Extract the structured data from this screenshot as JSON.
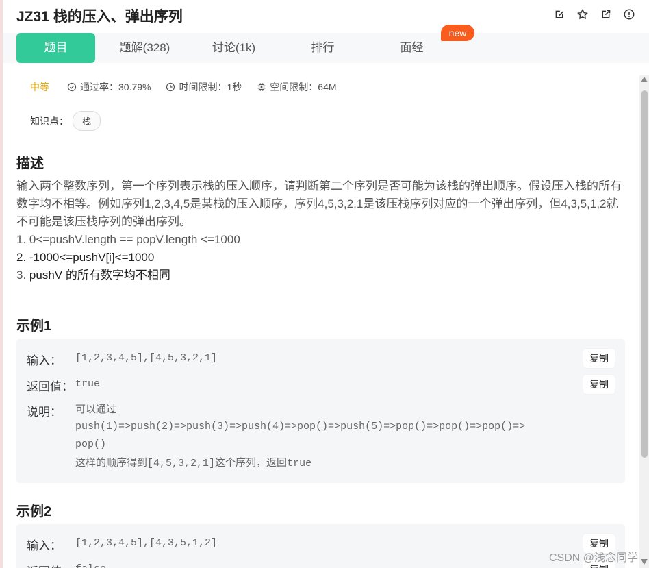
{
  "header": {
    "title": "JZ31  栈的压入、弹出序列",
    "icons": [
      "edit-icon",
      "star-icon",
      "share-icon",
      "info-icon"
    ]
  },
  "tabs": [
    {
      "label": "题目",
      "active": true
    },
    {
      "label": "题解(328)",
      "active": false
    },
    {
      "label": "讨论(1k)",
      "active": false
    },
    {
      "label": "排行",
      "active": false
    },
    {
      "label": "面经",
      "active": false
    }
  ],
  "new_badge": "new",
  "meta": {
    "difficulty": "中等",
    "pass_rate": "通过率：30.79%",
    "time_limit": "时间限制：1秒",
    "space_limit": "空间限制：64M"
  },
  "knowledge": {
    "label": "知识点：",
    "tag": "栈"
  },
  "description": {
    "heading": "描述",
    "para": "输入两个整数序列，第一个序列表示栈的压入顺序，请判断第二个序列是否可能为该栈的弹出顺序。假设压入栈的所有数字均不相等。例如序列1,2,3,4,5是某栈的压入顺序，序列4,5,3,2,1是该压栈序列对应的一个弹出序列，但4,3,5,1,2就不可能是该压栈序列的弹出序列。",
    "c1": "1. 0<=pushV.length == popV.length <=1000",
    "c2": "2. -1000<=pushV[i]<=1000",
    "c3_num": "3.",
    "c3_text": " pushV 的所有数字均不相同"
  },
  "example1": {
    "heading": "示例1",
    "input_label": "输入：",
    "input_value": "[1,2,3,4,5],[4,5,3,2,1]",
    "output_label": "返回值：",
    "output_value": "true",
    "explain_label": "说明：",
    "explain_l1": "可以通过",
    "explain_l2": "push(1)=>push(2)=>push(3)=>push(4)=>pop()=>push(5)=>pop()=>pop()=>pop()=>",
    "explain_l3": "pop()",
    "explain_l4a": "这样的顺序得到",
    "explain_l4b": "[4,5,3,2,1]",
    "explain_l4c": "这个序列，返回",
    "explain_l4d": "true",
    "copy": "复制"
  },
  "example2": {
    "heading": "示例2",
    "input_label": "输入：",
    "input_value": "[1,2,3,4,5],[4,3,5,1,2]",
    "output_label": "返回值：",
    "output_value": "false",
    "copy": "复制"
  },
  "watermark": "CSDN @浅念同学"
}
